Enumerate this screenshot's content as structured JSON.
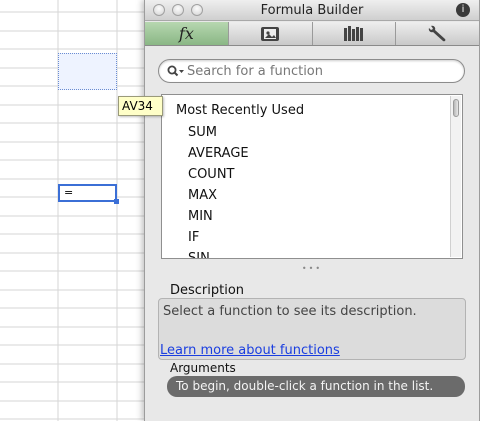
{
  "spreadsheet": {
    "tooltip": "AV34",
    "edit_value": "="
  },
  "window": {
    "title": "Formula Builder"
  },
  "tabs": [
    {
      "label": "fx",
      "icon": "fx-icon",
      "active": true
    },
    {
      "label": "",
      "icon": "media-browser-icon",
      "active": false
    },
    {
      "label": "",
      "icon": "library-icon",
      "active": false
    },
    {
      "label": "",
      "icon": "wrench-icon",
      "active": false
    }
  ],
  "search": {
    "placeholder": "Search for a function"
  },
  "list": {
    "heading": "Most Recently Used",
    "items": [
      "SUM",
      "AVERAGE",
      "COUNT",
      "MAX",
      "MIN",
      "IF",
      "SIN"
    ]
  },
  "description": {
    "label": "Description",
    "text": "Select a function to see its description.",
    "link": "Learn more about functions"
  },
  "arguments": {
    "label": "Arguments",
    "hint": "To begin, double-click a function in the list."
  },
  "colors": {
    "active_tab": "#9cc596",
    "link": "#1a3ee0",
    "selection": "#3b6fd6"
  }
}
